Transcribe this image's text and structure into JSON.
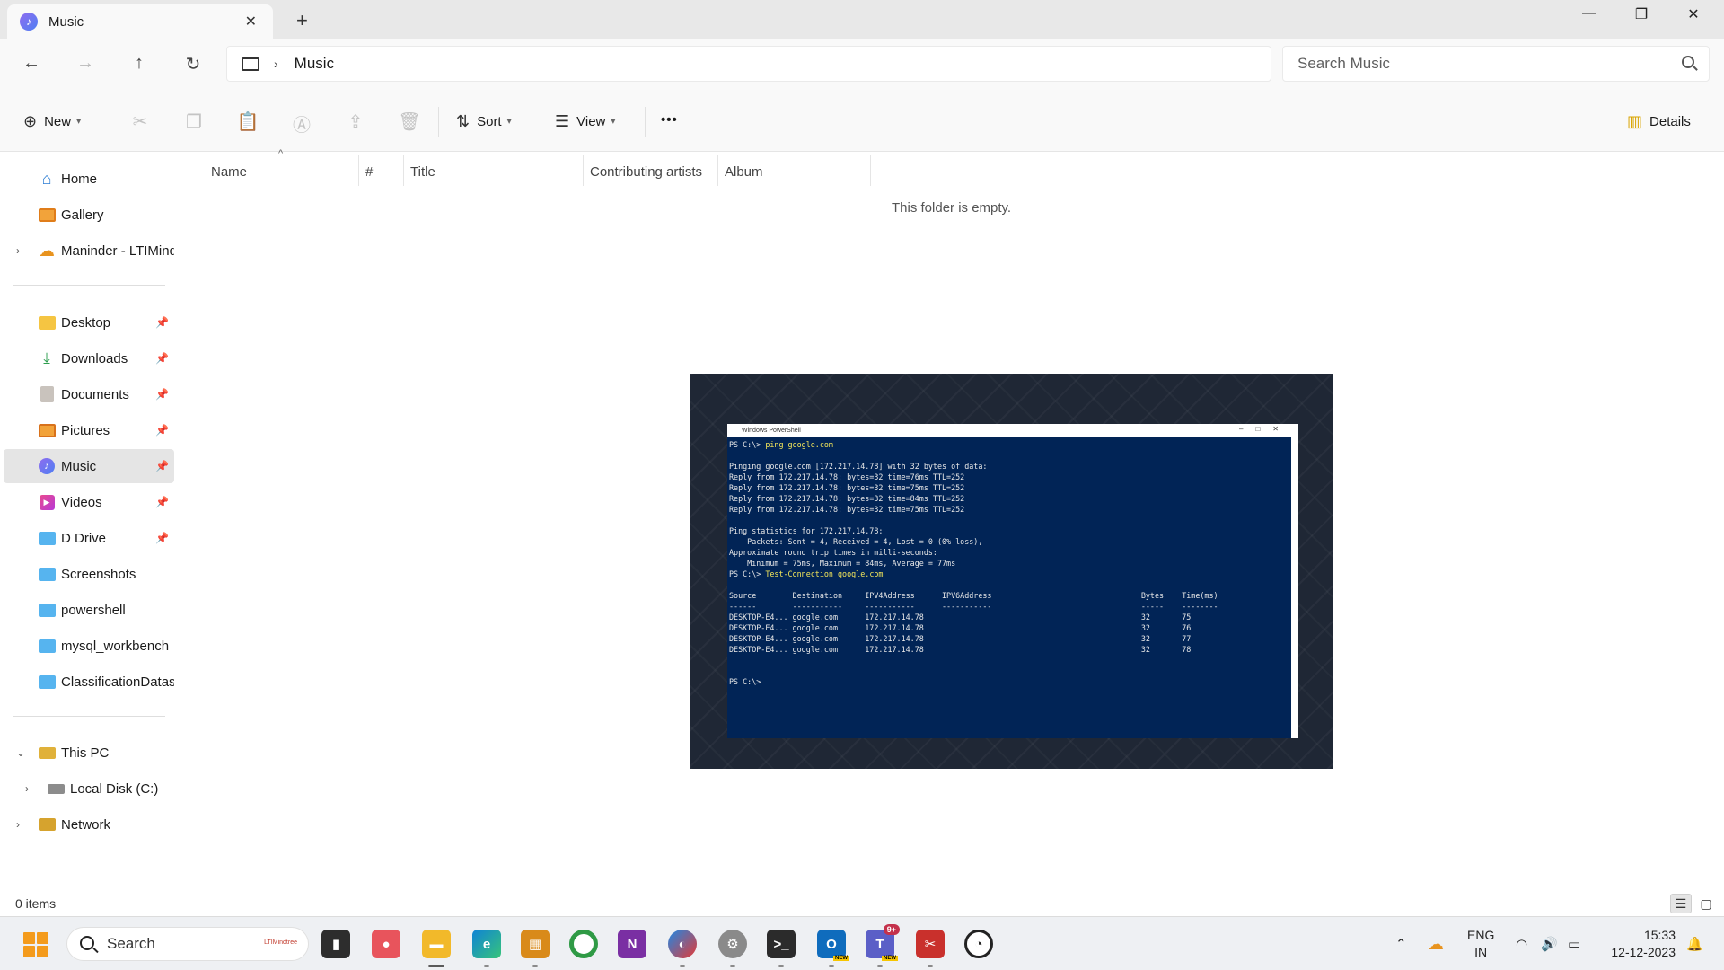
{
  "window": {
    "tab_label": "Music",
    "tab_close": "✕",
    "new_tab": "+",
    "minimize": "—",
    "maximize": "❐",
    "close": "✕"
  },
  "nav": {
    "breadcrumb_current": "Music",
    "search_placeholder": "Search Music"
  },
  "command_bar": {
    "new_label": "New",
    "sort_label": "Sort",
    "view_label": "View",
    "more_label": "•••",
    "details_label": "Details"
  },
  "sidebar": {
    "items": [
      {
        "label": "Home"
      },
      {
        "label": "Gallery"
      },
      {
        "label": "Maninder - LTIMind"
      },
      {
        "label": "Desktop"
      },
      {
        "label": "Downloads"
      },
      {
        "label": "Documents"
      },
      {
        "label": "Pictures"
      },
      {
        "label": "Music"
      },
      {
        "label": "Videos"
      },
      {
        "label": "D Drive"
      },
      {
        "label": "Screenshots"
      },
      {
        "label": "powershell"
      },
      {
        "label": "mysql_workbench"
      },
      {
        "label": "ClassificationDatas"
      },
      {
        "label": "This PC"
      },
      {
        "label": "Local Disk (C:)"
      },
      {
        "label": "Network"
      }
    ]
  },
  "content": {
    "columns": [
      "Name",
      "#",
      "Title",
      "Contributing artists",
      "Album"
    ],
    "empty_message": "This folder is empty."
  },
  "preview_image": {
    "window_title": "Windows PowerShell",
    "lines": [
      "PS C:\\> ping google.com",
      "",
      "Pinging google.com [172.217.14.78] with 32 bytes of data:",
      "Reply from 172.217.14.78: bytes=32 time=76ms TTL=252",
      "Reply from 172.217.14.78: bytes=32 time=75ms TTL=252",
      "Reply from 172.217.14.78: bytes=32 time=84ms TTL=252",
      "Reply from 172.217.14.78: bytes=32 time=75ms TTL=252",
      "",
      "Ping statistics for 172.217.14.78:",
      "    Packets: Sent = 4, Received = 4, Lost = 0 (0% loss),",
      "Approximate round trip times in milli-seconds:",
      "    Minimum = 75ms, Maximum = 84ms, Average = 77ms",
      "PS C:\\> Test-Connection google.com",
      "",
      "Source        Destination     IPV4Address      IPV6Address                                 Bytes    Time(ms)",
      "------        -----------     -----------      -----------                                 -----    --------",
      "DESKTOP-E4... google.com      172.217.14.78                                                32       75",
      "DESKTOP-E4... google.com      172.217.14.78                                                32       76",
      "DESKTOP-E4... google.com      172.217.14.78                                                32       77",
      "DESKTOP-E4... google.com      172.217.14.78                                                32       78",
      "",
      "",
      "PS C:\\>"
    ]
  },
  "status_bar": {
    "item_count": "0 items"
  },
  "taskbar": {
    "search_label": "Search",
    "search_brand": "LTIMindtree",
    "teams_badge": "9+",
    "new_tag": "NEW",
    "lang_line1": "ENG",
    "lang_line2": "IN",
    "time": "15:33",
    "date": "12-12-2023"
  },
  "colors": {
    "accent": "#005fb8",
    "powershell_bg": "#012456",
    "selected_item_bg": "#e5e5e5"
  }
}
